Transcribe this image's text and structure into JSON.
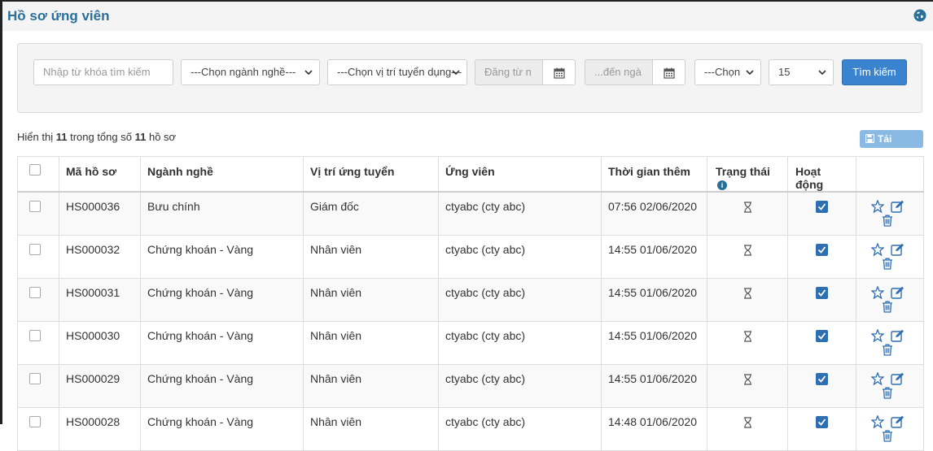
{
  "page": {
    "title": "Hồ sơ ứng viên"
  },
  "filters": {
    "keyword_placeholder": "Nhập từ khóa tìm kiếm",
    "industry_select": "---Chọn ngành nghề---",
    "position_select": "---Chọn vị trí tuyển dụng---",
    "date_from_placeholder": "Đăng từ n",
    "date_to_placeholder": "...đến ngà",
    "status_select": "---Chọn",
    "page_size_select": "15",
    "search_button": "Tìm kiếm"
  },
  "summary": {
    "prefix": "Hiển thị",
    "shown": "11",
    "middle": "trong tổng số",
    "total": "11",
    "suffix": "hồ sơ"
  },
  "download_button": "Tải xuống",
  "table": {
    "headers": {
      "code": "Mã hồ sơ",
      "industry": "Ngành nghề",
      "position": "Vị trí ứng tuyển",
      "candidate": "Ứng viên",
      "time_added": "Thời gian thêm",
      "status": "Trạng thái",
      "active": "Hoạt động"
    },
    "rows": [
      {
        "code": "HS000036",
        "industry": "Bưu chính",
        "position": "Giám đốc",
        "candidate": "ctyabc (cty abc)",
        "time_added": "07:56 02/06/2020",
        "active": true
      },
      {
        "code": "HS000032",
        "industry": "Chứng khoán - Vàng",
        "position": "Nhân viên",
        "candidate": "ctyabc (cty abc)",
        "time_added": "14:55 01/06/2020",
        "active": true
      },
      {
        "code": "HS000031",
        "industry": "Chứng khoán - Vàng",
        "position": "Nhân viên",
        "candidate": "ctyabc (cty abc)",
        "time_added": "14:55 01/06/2020",
        "active": true
      },
      {
        "code": "HS000030",
        "industry": "Chứng khoán - Vàng",
        "position": "Nhân viên",
        "candidate": "ctyabc (cty abc)",
        "time_added": "14:55 01/06/2020",
        "active": true
      },
      {
        "code": "HS000029",
        "industry": "Chứng khoán - Vàng",
        "position": "Nhân viên",
        "candidate": "ctyabc (cty abc)",
        "time_added": "14:55 01/06/2020",
        "active": true
      },
      {
        "code": "HS000028",
        "industry": "Chứng khoán - Vàng",
        "position": "Nhân viên",
        "candidate": "ctyabc (cty abc)",
        "time_added": "14:48 01/06/2020",
        "active": true
      }
    ]
  },
  "icons": {
    "globe": "globe-icon",
    "calendar": "calendar-icon",
    "status": "hourglass-icon",
    "favorite": "star-icon",
    "edit": "edit-icon",
    "delete": "trash-icon",
    "download": "floppy-icon",
    "info": "info-icon"
  },
  "colors": {
    "title": "#2a6f9a",
    "primary_button": "#3a84cf",
    "download_button": "#8ab9e3",
    "checkbox_checked": "#2e6fb2"
  }
}
